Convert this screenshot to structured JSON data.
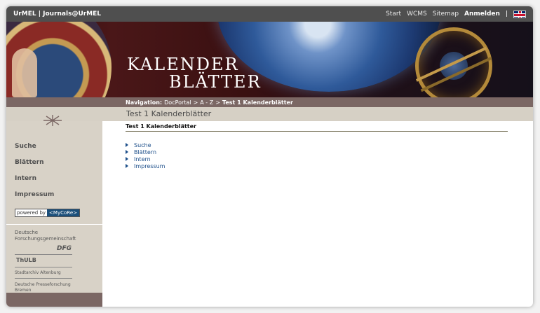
{
  "topbar": {
    "brand": "UrMEL | Journals@UrMEL",
    "links": [
      "Start",
      "WCMS",
      "Sitemap"
    ],
    "login": "Anmelden",
    "separator": "|",
    "flag_icon": "uk-flag-icon"
  },
  "banner": {
    "logo_line1": "KALENDER",
    "logo_line2": "BLÄTTER"
  },
  "breadcrumb": {
    "label": "Navigation:",
    "items": [
      "DocPortal",
      "A - Z"
    ],
    "separator": ">",
    "current": "Test 1 Kalenderblätter"
  },
  "page_title": "Test 1 Kalenderblätter",
  "sidebar": {
    "menu": [
      "Suche",
      "Blättern",
      "Intern",
      "Impressum"
    ],
    "powered_by": "powered by",
    "mycore": "<MyCoRe>",
    "sponsors": {
      "dfg_line1": "Deutsche",
      "dfg_line2": "Forschungsgemeinschaft",
      "dfg_mark": "DFG",
      "thulb": "ThULB",
      "stadtarchiv": "Stadtarchiv Altenburg",
      "presse_line1": "Deutsche Presseforschung",
      "presse_line2": "Bremen"
    }
  },
  "main": {
    "heading": "Test 1 Kalenderblätter",
    "links": [
      "Suche",
      "Blättern",
      "Intern",
      "Impressum"
    ]
  },
  "colors": {
    "topbar": "#4f4f4f",
    "nav_band": "#7b6764",
    "sidebar": "#d8d2c7",
    "link": "#1d4f8a"
  }
}
